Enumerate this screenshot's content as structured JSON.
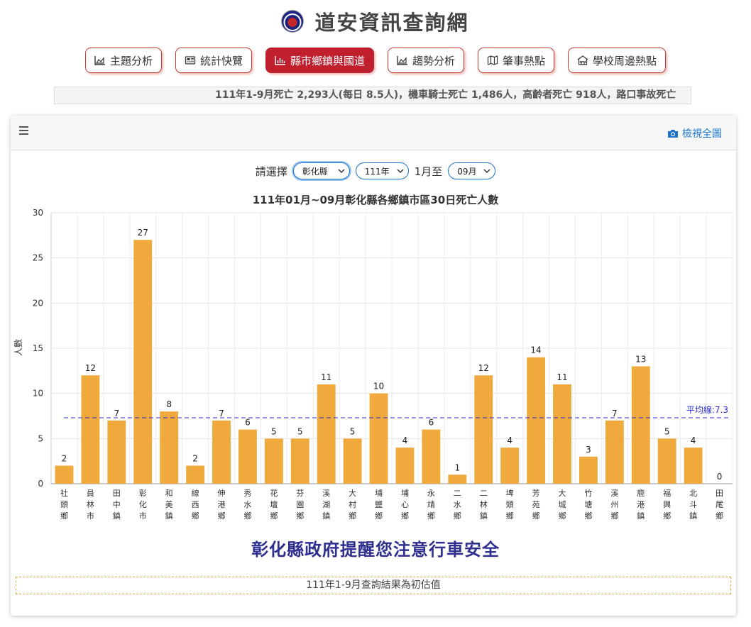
{
  "site": {
    "title": "道安資訊查詢網"
  },
  "nav": [
    {
      "label": "主題分析",
      "icon": "area-chart-icon",
      "active": false
    },
    {
      "label": "統計快覽",
      "icon": "newspaper-icon",
      "active": false
    },
    {
      "label": "縣市鄉鎮與國道",
      "icon": "bar-chart-icon",
      "active": true
    },
    {
      "label": "趨勢分析",
      "icon": "line-chart-icon",
      "active": false
    },
    {
      "label": "肇事熱點",
      "icon": "map-icon",
      "active": false
    },
    {
      "label": "學校周邊熱點",
      "icon": "school-icon",
      "active": false
    }
  ],
  "ticker": {
    "text": "111年1-9月死亡 2,293人(每日 8.5人)，機車騎士死亡 1,486人，高齡者死亡 918人，路口事故死亡"
  },
  "panel": {
    "view_full_label": "檢視全圖"
  },
  "filters": {
    "prompt": "請選擇",
    "county": "彰化縣",
    "year": "111年",
    "from_text": "1月至",
    "month": "09月"
  },
  "chart_title": "111年01月~09月彰化縣各鄉鎮市區30日死亡人數",
  "chart_data": {
    "type": "bar",
    "title": "111年01月~09月彰化縣各鄉鎮市區30日死亡人數",
    "ylabel": "人數",
    "ylim": [
      0,
      30
    ],
    "yticks": [
      0,
      5,
      10,
      15,
      20,
      25,
      30
    ],
    "categories": [
      "社頭鄉",
      "員林市",
      "田中鎮",
      "彰化市",
      "和美鎮",
      "線西鄉",
      "伸港鄉",
      "秀水鄉",
      "花壇鄉",
      "芬園鄉",
      "溪湖鎮",
      "大村鄉",
      "埔鹽鄉",
      "埔心鄉",
      "永靖鄉",
      "二水鄉",
      "二林鎮",
      "埤頭鄉",
      "芳苑鄉",
      "大城鄉",
      "竹塘鄉",
      "溪州鄉",
      "鹿港鎮",
      "福興鄉",
      "北斗鎮",
      "田尾鄉"
    ],
    "values": [
      2,
      12,
      7,
      27,
      8,
      2,
      7,
      6,
      5,
      5,
      11,
      5,
      10,
      4,
      6,
      1,
      12,
      4,
      14,
      11,
      3,
      7,
      13,
      5,
      4,
      0
    ],
    "average": 7.3,
    "average_label": "平均線:7.3",
    "bar_color": "#f0a93c",
    "average_color": "#2a2ad0",
    "grid": true,
    "legend": "none"
  },
  "footer_message": "彰化縣政府提醒您注意行車安全",
  "note": "111年1-9月查詢結果為初估值"
}
